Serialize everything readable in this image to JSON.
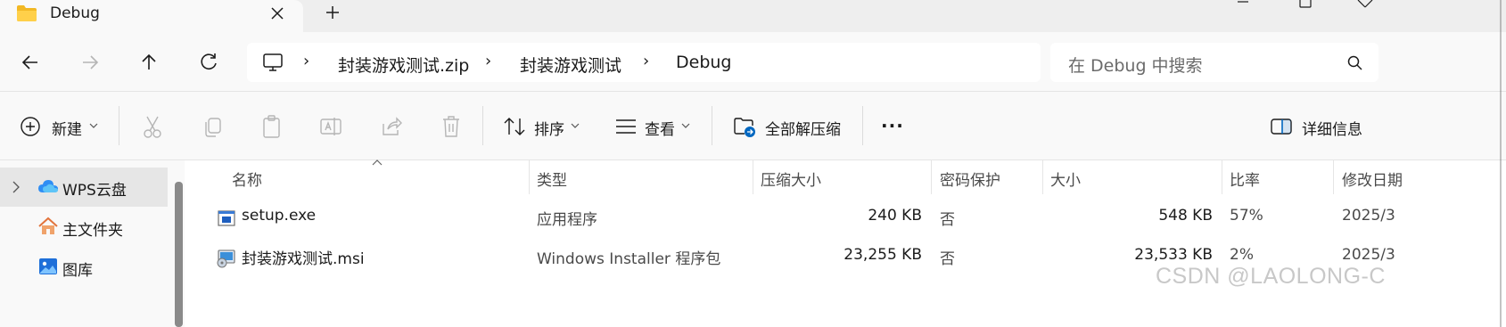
{
  "tab": {
    "title": "Debug"
  },
  "address": {
    "crumbs": [
      "封装游戏测试.zip",
      "封装游戏测试",
      "Debug"
    ]
  },
  "search": {
    "placeholder": "在 Debug 中搜索"
  },
  "toolbar": {
    "new_label": "新建",
    "sort_label": "排序",
    "view_label": "查看",
    "extract_label": "全部解压缩",
    "more_label": "···",
    "details_label": "详细信息"
  },
  "sidebar": {
    "items": [
      {
        "label": "WPS云盘",
        "icon": "cloud-icon",
        "selected": true
      },
      {
        "label": "主文件夹",
        "icon": "home-icon"
      },
      {
        "label": "图库",
        "icon": "gallery-icon"
      }
    ]
  },
  "columns": [
    "名称",
    "类型",
    "压缩大小",
    "密码保护",
    "大小",
    "比率",
    "修改日期"
  ],
  "files": [
    {
      "name": "setup.exe",
      "type": "应用程序",
      "compressed": "240 KB",
      "password": "否",
      "size": "548 KB",
      "ratio": "57%",
      "modified": "2025/3",
      "icon": "exe-icon"
    },
    {
      "name": "封装游戏测试.msi",
      "type": "Windows Installer 程序包",
      "compressed": "23,255 KB",
      "password": "否",
      "size": "23,533 KB",
      "ratio": "2%",
      "modified": "2025/3",
      "icon": "msi-icon"
    }
  ],
  "watermark": "CSDN @LAOLONG-C",
  "colors": {
    "accent": "#0067c0",
    "folder": "#f4c542"
  }
}
